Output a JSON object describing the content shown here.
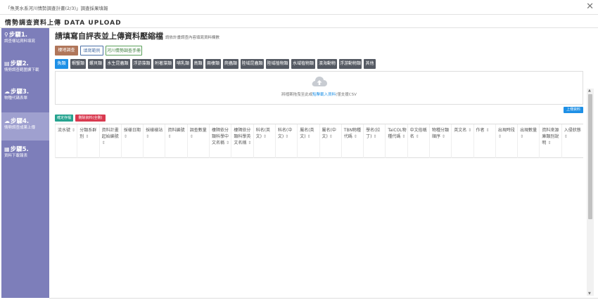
{
  "window": {
    "title": "「魚美水系河川情勢調查計畫(2/3)」調查採果填報",
    "close_icon": "close-icon"
  },
  "page": {
    "heading": "情勢調查資料上傳 DATA UPLOAD"
  },
  "sidebar": {
    "steps": [
      {
        "icon": "location-pin-icon",
        "title": "步驟1.",
        "subtitle": "調查樣站資料填寫",
        "active": false
      },
      {
        "icon": "layers-icon",
        "title": "步驟2.",
        "subtitle": "情勢調查範圍擴下載",
        "active": false
      },
      {
        "icon": "cloud-upload-icon",
        "title": "步驟3.",
        "subtitle": "物種代碼表單",
        "active": false
      },
      {
        "icon": "cloud-upload-icon",
        "title": "步驟4.",
        "subtitle": "情勢調查成果上傳",
        "active": true
      },
      {
        "icon": "book-icon",
        "title": "步驟5.",
        "subtitle": "資料下載報表",
        "active": false
      }
    ]
  },
  "main": {
    "title": "請填寫自評表並上傳資料壓縮檔",
    "subtitle": "請依計畫調查內容填寫資料欄數",
    "tabs": [
      {
        "label": "棲地調查",
        "style": "brown"
      },
      {
        "label": "填寫範例",
        "style": "outline-blue"
      },
      {
        "label": "河川情勢調查手冊",
        "style": "outline-green"
      }
    ],
    "categories": [
      {
        "label": "魚類",
        "active": true
      },
      {
        "label": "蝦蟹類",
        "active": false
      },
      {
        "label": "螺貝類",
        "active": false
      },
      {
        "label": "水生昆蟲類",
        "active": false
      },
      {
        "label": "浮游藻類",
        "active": false
      },
      {
        "label": "附著藻類",
        "active": false
      },
      {
        "label": "哺乳類",
        "active": false
      },
      {
        "label": "鳥類",
        "active": false
      },
      {
        "label": "兩棲類",
        "active": false
      },
      {
        "label": "爬蟲類",
        "active": false
      },
      {
        "label": "陸域昆蟲類",
        "active": false
      },
      {
        "label": "陸域植物類",
        "active": false
      },
      {
        "label": "水域植物類",
        "active": false
      },
      {
        "label": "濱海動物",
        "active": false
      },
      {
        "label": "浮游動物類",
        "active": false
      },
      {
        "label": "其他",
        "active": false
      }
    ],
    "upload": {
      "icon": "cloud-upload-icon",
      "text_before": "將檔案拖曳至此或",
      "link": "點擊載入資料",
      "text_after": "(僅支援CSV"
    },
    "upload_button": "上傳資料",
    "action_buttons": [
      {
        "label": "確定存檔",
        "style": "teal"
      },
      {
        "label": "刪除資料(全刪)",
        "style": "red"
      }
    ],
    "table": {
      "sort_icon": "⇕",
      "columns": [
        "流水號",
        "分類系群別",
        "資料計畫起始編號",
        "採樣日期",
        "採樣樣站",
        "資料編號",
        "調查數量",
        "棲隔依分類科學中文名稱",
        "棲隔依分類科學英文名稱",
        "科名(英文)",
        "科名(中文)",
        "屬名(英文)",
        "屬名(中文)",
        "TBN物種代碼",
        "學名(拉丁)",
        "TaiCOL物種代碼",
        "中文俗稱名",
        "物種分類順序",
        "英文名",
        "作者",
        "出現時段",
        "出現數量",
        "資料來源庫類別說明",
        "入侵狀態"
      ]
    }
  }
}
